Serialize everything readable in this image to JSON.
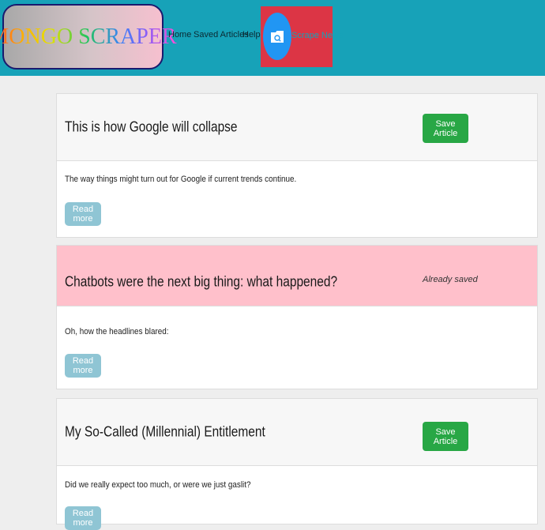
{
  "nav": {
    "brand": "MONGO SCRAPER",
    "links": [
      "Home",
      "Saved Articles",
      "Help"
    ],
    "scrape_label": "Scrape News",
    "scrape_icon": "search-folder-icon"
  },
  "articles": [
    {
      "title": "This is how Google will collapse",
      "summary": "The way things might turn out for Google if current trends continue.",
      "saved": false,
      "save_label": "Save Article",
      "read_more_label": "Read more"
    },
    {
      "title": "Chatbots were the next big thing: what happened?",
      "summary": "Oh, how the headlines blared:",
      "saved": true,
      "saved_label": "Already saved",
      "read_more_label": "Read more"
    },
    {
      "title": "My So-Called (Millennial) Entitlement",
      "summary": "Did we really expect too much, or were we just gaslit?",
      "saved": false,
      "save_label": "Save Article",
      "read_more_label": "Read more"
    }
  ],
  "colors": {
    "navbar": "#17a2b8",
    "scrape_box": "#dc3545",
    "save_button": "#28a745",
    "saved_header": "#ffc0cb",
    "read_more": "#8fc5d4"
  }
}
